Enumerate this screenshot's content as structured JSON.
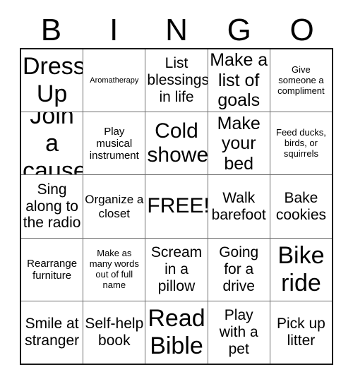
{
  "card": {
    "title_letters": [
      "B",
      "I",
      "N",
      "G",
      "O"
    ],
    "free_space_label": "FREE!",
    "colors": {
      "text": "#000000",
      "outer_border": "#1a1a1a",
      "inner_border": "#6e6e6e",
      "background": "#ffffff"
    },
    "grid": {
      "columns": 5,
      "rows": 5,
      "cells": [
        [
          {
            "text": "Dress Up",
            "size": "fs-xxl"
          },
          {
            "text": "Aromatherapy",
            "size": "fs-tiny"
          },
          {
            "text": "List blessings in life",
            "size": "fs-m"
          },
          {
            "text": "Make a list of goals",
            "size": "fs-l"
          },
          {
            "text": "Give someone a compliment",
            "size": "fs-xxs"
          }
        ],
        [
          {
            "text": "Join a cause",
            "size": "fs-xxl"
          },
          {
            "text": "Play musical instrument",
            "size": "fs-xs"
          },
          {
            "text": "Cold shower",
            "size": "fs-xl"
          },
          {
            "text": "Make your bed",
            "size": "fs-l"
          },
          {
            "text": "Feed ducks, birds, or squirrels",
            "size": "fs-xxs"
          }
        ],
        [
          {
            "text": "Sing along to the radio",
            "size": "fs-m"
          },
          {
            "text": "Organize a closet",
            "size": "fs-s"
          },
          {
            "text": "FREE!",
            "size": "fs-xl"
          },
          {
            "text": "Walk barefoot",
            "size": "fs-m"
          },
          {
            "text": "Bake cookies",
            "size": "fs-m"
          }
        ],
        [
          {
            "text": "Rearrange furniture",
            "size": "fs-xs"
          },
          {
            "text": "Make as many words out of full name",
            "size": "fs-xxs"
          },
          {
            "text": "Scream in a pillow",
            "size": "fs-m"
          },
          {
            "text": "Going for a drive",
            "size": "fs-m"
          },
          {
            "text": "Bike ride",
            "size": "fs-xxl"
          }
        ],
        [
          {
            "text": "Smile at stranger",
            "size": "fs-m"
          },
          {
            "text": "Self-help book",
            "size": "fs-m"
          },
          {
            "text": "Read Bible",
            "size": "fs-xxl"
          },
          {
            "text": "Play with a pet",
            "size": "fs-m"
          },
          {
            "text": "Pick up litter",
            "size": "fs-m"
          }
        ]
      ]
    }
  }
}
